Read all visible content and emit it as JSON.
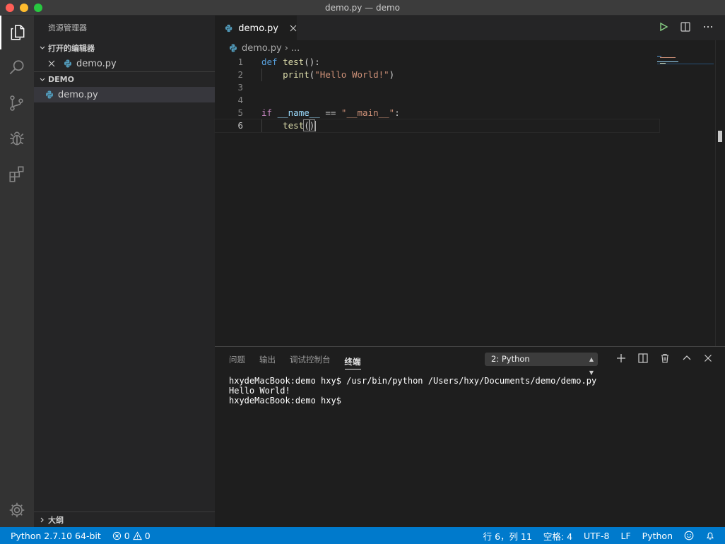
{
  "window": {
    "title": "demo.py — demo"
  },
  "sidebar": {
    "title": "资源管理器",
    "open_editors": {
      "label": "打开的编辑器",
      "items": [
        {
          "name": "demo.py"
        }
      ]
    },
    "folder": {
      "label": "DEMO",
      "items": [
        {
          "name": "demo.py"
        }
      ]
    },
    "outline": {
      "label": "大纲"
    }
  },
  "editor": {
    "tab": {
      "label": "demo.py"
    },
    "breadcrumb": {
      "file": "demo.py",
      "separator": "›",
      "more": "..."
    },
    "lines": [
      {
        "n": "1",
        "tokens": [
          {
            "t": "def",
            "c": "kw"
          },
          {
            "t": " "
          },
          {
            "t": "test",
            "c": "fn"
          },
          {
            "t": "():",
            "c": "op"
          }
        ]
      },
      {
        "n": "2",
        "tokens": [
          {
            "t": "    "
          },
          {
            "t": "print",
            "c": "fn"
          },
          {
            "t": "(",
            "c": "op"
          },
          {
            "t": "\"Hello World!\"",
            "c": "str"
          },
          {
            "t": ")",
            "c": "op"
          }
        ]
      },
      {
        "n": "3",
        "tokens": []
      },
      {
        "n": "4",
        "tokens": []
      },
      {
        "n": "5",
        "tokens": [
          {
            "t": "if",
            "c": "kw2"
          },
          {
            "t": " "
          },
          {
            "t": "__name__",
            "c": "var"
          },
          {
            "t": " == ",
            "c": "op"
          },
          {
            "t": "\"__main__\"",
            "c": "str"
          },
          {
            "t": ":",
            "c": "op"
          }
        ]
      },
      {
        "n": "6",
        "tokens": [
          {
            "t": "    "
          },
          {
            "t": "test",
            "c": "fn"
          },
          {
            "t": "(",
            "c": "op bracket-hl"
          },
          {
            "t": ")",
            "c": "op bracket-hl"
          }
        ]
      }
    ]
  },
  "panel": {
    "tabs": [
      {
        "label": "问题"
      },
      {
        "label": "输出"
      },
      {
        "label": "调试控制台"
      },
      {
        "label": "终端"
      }
    ],
    "terminal_selector": "2: Python",
    "terminal_lines": [
      "hxydeMacBook:demo hxy$ /usr/bin/python /Users/hxy/Documents/demo/demo.py",
      "Hello World!",
      "hxydeMacBook:demo hxy$ "
    ]
  },
  "statusbar": {
    "interpreter": "Python 2.7.10 64-bit",
    "errors": "0",
    "warnings": "0",
    "position": "行 6，列 11",
    "indent": "空格: 4",
    "encoding": "UTF-8",
    "eol": "LF",
    "language": "Python"
  },
  "colors": {
    "accent": "#007acc",
    "activity_bar": "#333333",
    "sidebar": "#252526",
    "editor": "#1e1e1e"
  },
  "icons": [
    "files-icon",
    "search-icon",
    "source-control-icon",
    "debug-icon",
    "extensions-icon",
    "gear-icon",
    "python-file-icon",
    "run-icon",
    "split-editor-icon",
    "more-icon",
    "plus-icon",
    "split-terminal-icon",
    "trash-icon",
    "maximize-icon",
    "close-icon",
    "error-icon",
    "warning-icon",
    "smiley-icon",
    "bell-icon"
  ]
}
